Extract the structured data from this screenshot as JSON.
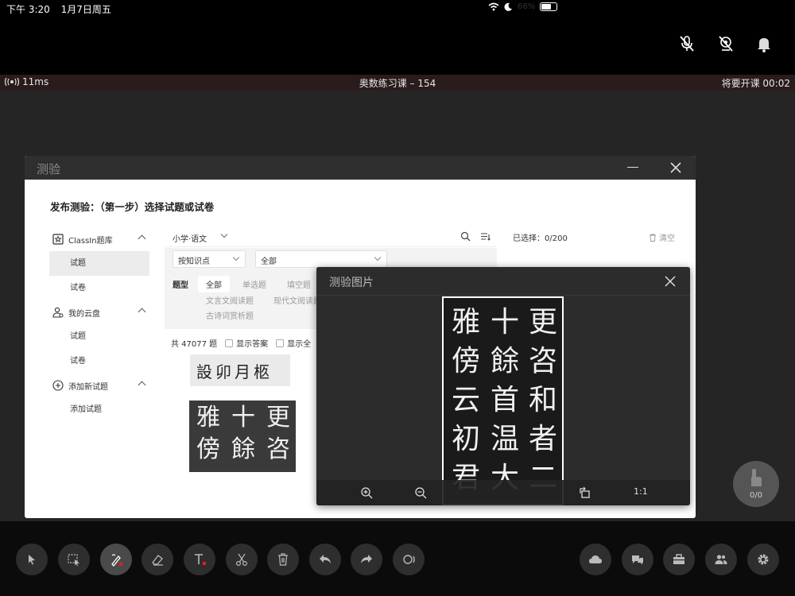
{
  "status_bar": {
    "time": "下午 3:20",
    "date": "1月7日周五",
    "battery": "66%",
    "battery_fraction": 0.66
  },
  "class_bar": {
    "latency": "11ms",
    "title": "奥数练习课 – 154",
    "countdown": "将要开课 00:02"
  },
  "quiz": {
    "window_title": "测验",
    "heading": "发布测验：（第一步）选择试题或试卷",
    "sidebar": {
      "groups": [
        {
          "label": "ClassIn题库",
          "icon": "library-icon",
          "items": [
            "试题",
            "试卷"
          ]
        },
        {
          "label": "我的云盘",
          "icon": "user-cloud-icon",
          "items": [
            "试题",
            "试卷"
          ]
        },
        {
          "label": "添加新试题",
          "icon": "plus-circle-icon",
          "items": [
            "添加试题"
          ]
        }
      ]
    },
    "toolbar": {
      "subject": "小学·语文"
    },
    "filters": {
      "knowledge_select": "按知识点",
      "range_select": "全部",
      "type_label": "题型",
      "tags": [
        "全部",
        "单选题",
        "填空题",
        "文言文阅读题",
        "现代文阅读题",
        "古诗词赏析题"
      ]
    },
    "count_text": "共 47077 题",
    "show_answer": "显示答案",
    "show_all": "显示全",
    "thumb1_text": "設卯月柩",
    "thumb2_cols": [
      [
        "更",
        "咨"
      ],
      [
        "十",
        "餘"
      ],
      [
        "雅",
        "傍"
      ]
    ],
    "selected": "已选择：0/200",
    "clear": "清空"
  },
  "viewer": {
    "title": "测验图片",
    "image_columns": [
      [
        "更",
        "咨",
        "和",
        "者",
        "二"
      ],
      [
        "十",
        "餘",
        "首",
        "温",
        "大"
      ],
      [
        "雅",
        "傍",
        "云",
        "初",
        "君"
      ]
    ],
    "ratio_label": "1:1"
  },
  "hand_raise": {
    "count": "0/0"
  },
  "colors": {
    "bar_bg": "#2a1c1c",
    "stage_bg": "#252525",
    "accent_red": "#e02020"
  }
}
